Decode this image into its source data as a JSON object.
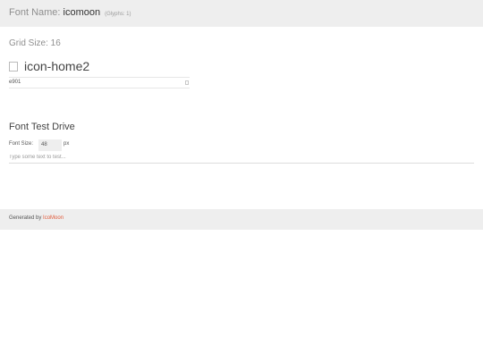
{
  "header": {
    "label": "Font Name:",
    "font_name": "icomoon",
    "glyph_count": "(Glyphs: 1)"
  },
  "grid": {
    "label": "Grid Size: 16"
  },
  "glyph": {
    "icon": "home-icon",
    "name": "icon-home2",
    "code": "e901"
  },
  "test_drive": {
    "title": "Font Test Drive",
    "size_label": "Font Size:",
    "size_value": "48",
    "size_unit": "px",
    "placeholder": "Type some text to test..."
  },
  "footer": {
    "generated_by": "Generated by",
    "link_label": "IcoMoon",
    "link_color": "#e05a3a"
  }
}
